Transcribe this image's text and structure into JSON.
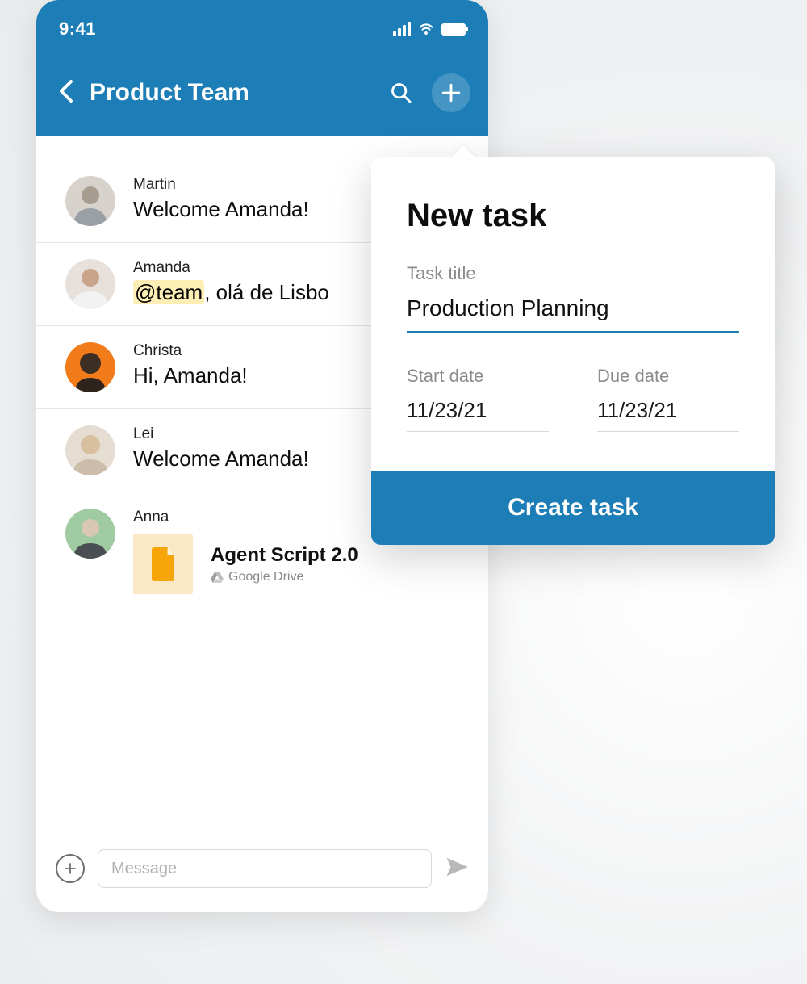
{
  "statusbar": {
    "time": "9:41"
  },
  "nav": {
    "title": "Product Team"
  },
  "messages": [
    {
      "sender": "Martin",
      "text": "Welcome Amanda!"
    },
    {
      "sender": "Amanda",
      "mention": "@team",
      "sep": ", ",
      "text_rest": "olá de Lisbo"
    },
    {
      "sender": "Christa",
      "text": "Hi, Amanda!"
    },
    {
      "sender": "Lei",
      "text": "Welcome Amanda!"
    },
    {
      "sender": "Anna",
      "attachment": {
        "name": "Agent Script 2.0",
        "source": "Google Drive"
      }
    }
  ],
  "composer": {
    "placeholder": "Message"
  },
  "popover": {
    "heading": "New task",
    "title_label": "Task title",
    "title_value": "Production Planning",
    "start_label": "Start date",
    "start_value": "11/23/21",
    "due_label": "Due date",
    "due_value": "11/23/21",
    "button": "Create task"
  },
  "avatars": {
    "martin_bg": "#d7d2cc",
    "amanda_bg": "#e8e1db",
    "christa_bg": "#f27b1a",
    "lei_bg": "#e6ddd2",
    "anna_bg": "#9fcaa2"
  }
}
